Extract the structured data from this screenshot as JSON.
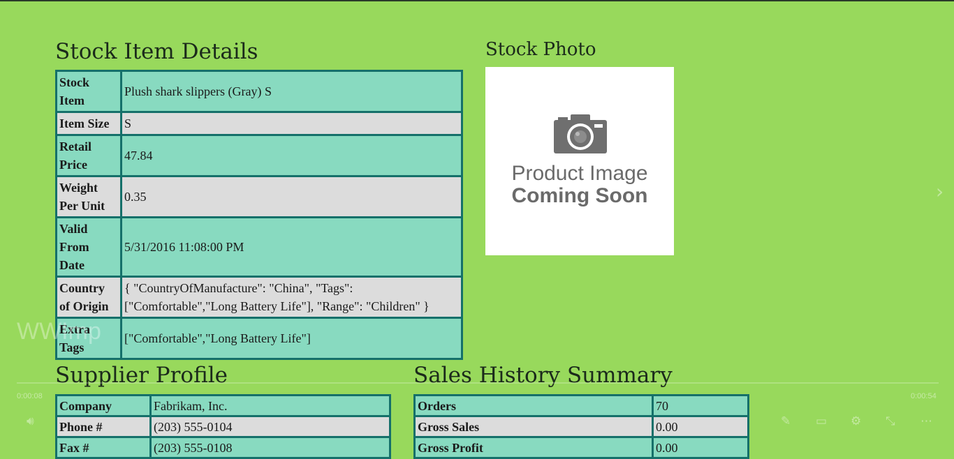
{
  "details": {
    "heading": "Stock Item Details",
    "rows": [
      {
        "label_l1": "Stock",
        "label_l2": "Item",
        "value": "Plush shark slippers (Gray) S"
      },
      {
        "label": "Item Size",
        "value": "S"
      },
      {
        "label_l1": "Retail",
        "label_l2": "Price",
        "value": "47.84"
      },
      {
        "label_l1": "Weight",
        "label_l2": "Per Unit",
        "value": "0.35"
      },
      {
        "label_l1": "Valid",
        "label_l2": "From",
        "label_l3": "Date",
        "value": "5/31/2016 11:08:00 PM"
      },
      {
        "label_l1": "Country",
        "label_l2": "of Origin",
        "value_l1": "{ \"CountryOfManufacture\": \"China\", \"Tags\":",
        "value_l2": "[\"Comfortable\",\"Long Battery Life\"], \"Range\": \"Children\" }"
      },
      {
        "label_l1": "Extra",
        "label_l2": "Tags",
        "value": "[\"Comfortable\",\"Long Battery Life\"]"
      }
    ]
  },
  "photo": {
    "heading": "Stock Photo",
    "placeholder_l1": "Product Image",
    "placeholder_l2": "Coming Soon",
    "icon": "camera-icon"
  },
  "supplier": {
    "heading": "Supplier Profile",
    "rows": [
      {
        "label": "Company",
        "value": "Fabrikam, Inc."
      },
      {
        "label": "Phone #",
        "value": "(203) 555-0104"
      },
      {
        "label": "Fax #",
        "value": "(203) 555-0108"
      }
    ]
  },
  "sales": {
    "heading": "Sales History Summary",
    "rows": [
      {
        "label": "Orders",
        "value": "70"
      },
      {
        "label": "Gross Sales",
        "value": "0.00"
      },
      {
        "label": "Gross Profit",
        "value": "0.00"
      }
    ]
  },
  "player": {
    "watermark": "WWImp",
    "time_elapsed": "0:00:08",
    "time_total": "0:00:54",
    "icons": [
      "volume-icon",
      "edit-icon",
      "captions-icon",
      "settings-icon",
      "minimize-icon",
      "more-icon",
      "next-arrow-icon"
    ]
  },
  "colors": {
    "background": "#98d95c",
    "row_teal": "#88dac0",
    "row_gray": "#dcdcdc",
    "border": "#15706a"
  }
}
